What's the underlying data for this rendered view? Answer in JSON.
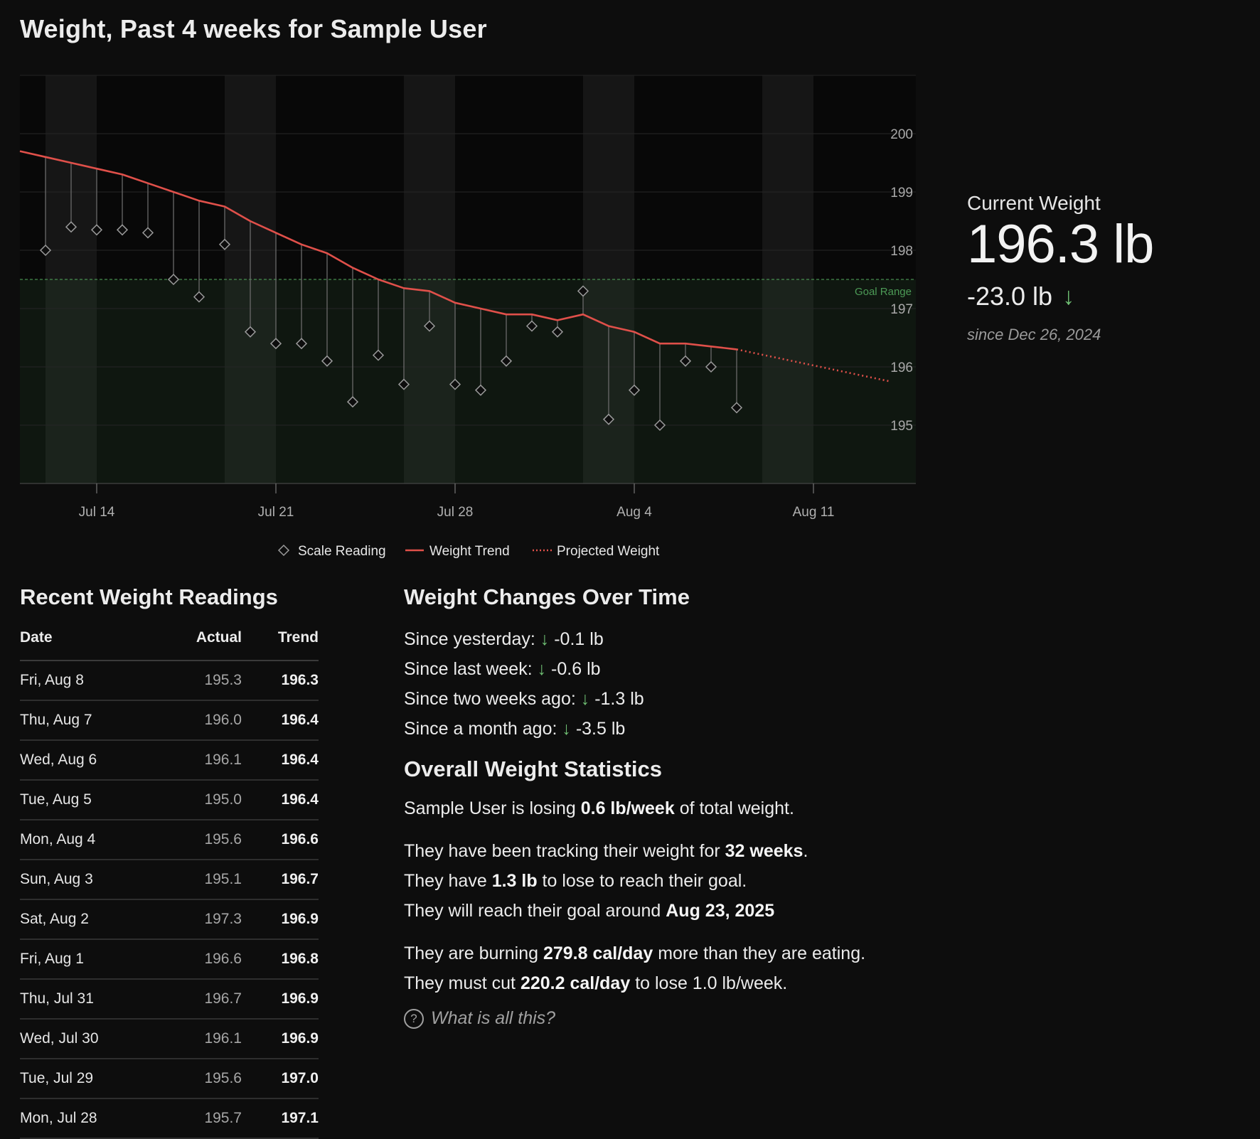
{
  "title": "Weight, Past 4 weeks for Sample User",
  "current_weight": {
    "label": "Current Weight",
    "value": "196.3 lb",
    "change": "-23.0 lb",
    "change_arrow": "↓",
    "since": "since Dec 26, 2024"
  },
  "colors": {
    "background": "#0d0d0d",
    "trend": "#e0504a",
    "goal": "#4c9a56",
    "scale_marker": "#9a9a9a",
    "down_arrow": "#6fbf73"
  },
  "chart_data": {
    "type": "line",
    "x_type": "date",
    "xlim": [
      "2025-07-11",
      "2025-08-15"
    ],
    "ylim": [
      194.0,
      201.0
    ],
    "y_ticks": [
      195,
      196,
      197,
      198,
      199,
      200
    ],
    "x_ticks": [
      {
        "date": "2025-07-14",
        "label": "Jul 14"
      },
      {
        "date": "2025-07-21",
        "label": "Jul 21"
      },
      {
        "date": "2025-07-28",
        "label": "Jul 28"
      },
      {
        "date": "2025-08-04",
        "label": "Aug 4"
      },
      {
        "date": "2025-08-11",
        "label": "Aug 11"
      }
    ],
    "grid": true,
    "weekend_shading": true,
    "goal_range": {
      "label": "Goal Range",
      "from": 194.0,
      "to": 197.5
    },
    "series": [
      {
        "name": "Scale Reading",
        "marker": "diamond",
        "points": [
          {
            "x": "2025-07-12",
            "y": 198.0
          },
          {
            "x": "2025-07-13",
            "y": 198.4
          },
          {
            "x": "2025-07-14",
            "y": 198.35
          },
          {
            "x": "2025-07-15",
            "y": 198.35
          },
          {
            "x": "2025-07-16",
            "y": 198.3
          },
          {
            "x": "2025-07-17",
            "y": 197.5
          },
          {
            "x": "2025-07-18",
            "y": 197.2
          },
          {
            "x": "2025-07-19",
            "y": 198.1
          },
          {
            "x": "2025-07-20",
            "y": 196.6
          },
          {
            "x": "2025-07-21",
            "y": 196.4
          },
          {
            "x": "2025-07-22",
            "y": 196.4
          },
          {
            "x": "2025-07-23",
            "y": 196.1
          },
          {
            "x": "2025-07-24",
            "y": 195.4
          },
          {
            "x": "2025-07-25",
            "y": 196.2
          },
          {
            "x": "2025-07-26",
            "y": 195.7
          },
          {
            "x": "2025-07-27",
            "y": 196.7
          },
          {
            "x": "2025-07-28",
            "y": 195.7
          },
          {
            "x": "2025-07-29",
            "y": 195.6
          },
          {
            "x": "2025-07-30",
            "y": 196.1
          },
          {
            "x": "2025-07-31",
            "y": 196.7
          },
          {
            "x": "2025-08-01",
            "y": 196.6
          },
          {
            "x": "2025-08-02",
            "y": 197.3
          },
          {
            "x": "2025-08-03",
            "y": 195.1
          },
          {
            "x": "2025-08-04",
            "y": 195.6
          },
          {
            "x": "2025-08-05",
            "y": 195.0
          },
          {
            "x": "2025-08-06",
            "y": 196.1
          },
          {
            "x": "2025-08-07",
            "y": 196.0
          },
          {
            "x": "2025-08-08",
            "y": 195.3
          }
        ]
      },
      {
        "name": "Weight Trend",
        "style": "solid",
        "points": [
          {
            "x": "2025-07-11",
            "y": 199.7
          },
          {
            "x": "2025-07-12",
            "y": 199.6
          },
          {
            "x": "2025-07-13",
            "y": 199.5
          },
          {
            "x": "2025-07-14",
            "y": 199.4
          },
          {
            "x": "2025-07-15",
            "y": 199.3
          },
          {
            "x": "2025-07-16",
            "y": 199.15
          },
          {
            "x": "2025-07-17",
            "y": 199.0
          },
          {
            "x": "2025-07-18",
            "y": 198.85
          },
          {
            "x": "2025-07-19",
            "y": 198.75
          },
          {
            "x": "2025-07-20",
            "y": 198.5
          },
          {
            "x": "2025-07-21",
            "y": 198.3
          },
          {
            "x": "2025-07-22",
            "y": 198.1
          },
          {
            "x": "2025-07-23",
            "y": 197.95
          },
          {
            "x": "2025-07-24",
            "y": 197.7
          },
          {
            "x": "2025-07-25",
            "y": 197.5
          },
          {
            "x": "2025-07-26",
            "y": 197.35
          },
          {
            "x": "2025-07-27",
            "y": 197.3
          },
          {
            "x": "2025-07-28",
            "y": 197.1
          },
          {
            "x": "2025-07-29",
            "y": 197.0
          },
          {
            "x": "2025-07-30",
            "y": 196.9
          },
          {
            "x": "2025-07-31",
            "y": 196.9
          },
          {
            "x": "2025-08-01",
            "y": 196.8
          },
          {
            "x": "2025-08-02",
            "y": 196.9
          },
          {
            "x": "2025-08-03",
            "y": 196.7
          },
          {
            "x": "2025-08-04",
            "y": 196.6
          },
          {
            "x": "2025-08-05",
            "y": 196.4
          },
          {
            "x": "2025-08-06",
            "y": 196.4
          },
          {
            "x": "2025-08-07",
            "y": 196.35
          },
          {
            "x": "2025-08-08",
            "y": 196.3
          }
        ]
      },
      {
        "name": "Projected Weight",
        "style": "dotted",
        "points": [
          {
            "x": "2025-08-08",
            "y": 196.3
          },
          {
            "x": "2025-08-14",
            "y": 195.75
          }
        ]
      }
    ]
  },
  "legend": {
    "scale": "Scale Reading",
    "trend": "Weight Trend",
    "projected": "Projected Weight"
  },
  "readings": {
    "title": "Recent Weight Readings",
    "headers": [
      "Date",
      "Actual",
      "Trend"
    ],
    "rows": [
      {
        "date": "Fri, Aug 8",
        "actual": "195.3",
        "trend": "196.3"
      },
      {
        "date": "Thu, Aug 7",
        "actual": "196.0",
        "trend": "196.4"
      },
      {
        "date": "Wed, Aug 6",
        "actual": "196.1",
        "trend": "196.4"
      },
      {
        "date": "Tue, Aug 5",
        "actual": "195.0",
        "trend": "196.4"
      },
      {
        "date": "Mon, Aug 4",
        "actual": "195.6",
        "trend": "196.6"
      },
      {
        "date": "Sun, Aug 3",
        "actual": "195.1",
        "trend": "196.7"
      },
      {
        "date": "Sat, Aug 2",
        "actual": "197.3",
        "trend": "196.9"
      },
      {
        "date": "Fri, Aug 1",
        "actual": "196.6",
        "trend": "196.8"
      },
      {
        "date": "Thu, Jul 31",
        "actual": "196.7",
        "trend": "196.9"
      },
      {
        "date": "Wed, Jul 30",
        "actual": "196.1",
        "trend": "196.9"
      },
      {
        "date": "Tue, Jul 29",
        "actual": "195.6",
        "trend": "197.0"
      },
      {
        "date": "Mon, Jul 28",
        "actual": "195.7",
        "trend": "197.1"
      }
    ]
  },
  "changes": {
    "title": "Weight Changes Over Time",
    "arrow": "↓",
    "items": [
      {
        "label": "Since yesterday:",
        "value": "-0.1 lb"
      },
      {
        "label": "Since last week:",
        "value": "-0.6 lb"
      },
      {
        "label": "Since two weeks ago:",
        "value": "-1.3 lb"
      },
      {
        "label": "Since a month ago:",
        "value": "-3.5 lb"
      }
    ]
  },
  "stats": {
    "title": "Overall Weight Statistics",
    "losing": {
      "a": "Sample User is losing ",
      "b": "0.6 lb/week",
      "c": " of total weight."
    },
    "tracking": {
      "a": "They have been tracking their weight for ",
      "b": "32 weeks",
      "c": "."
    },
    "to_lose": {
      "a": "They have ",
      "b": "1.3 lb",
      "c": " to lose to reach their goal."
    },
    "reach": {
      "a": "They will reach their goal around ",
      "b": "Aug 23, 2025",
      "c": ""
    },
    "burning": {
      "a": "They are burning ",
      "b": "279.8 cal/day",
      "c": " more than they are eating."
    },
    "cut": {
      "a": "They must cut ",
      "b": "220.2 cal/day",
      "c": " to lose 1.0 lb/week."
    },
    "help": "What is all this?",
    "help_icon": "question-circle-icon"
  }
}
